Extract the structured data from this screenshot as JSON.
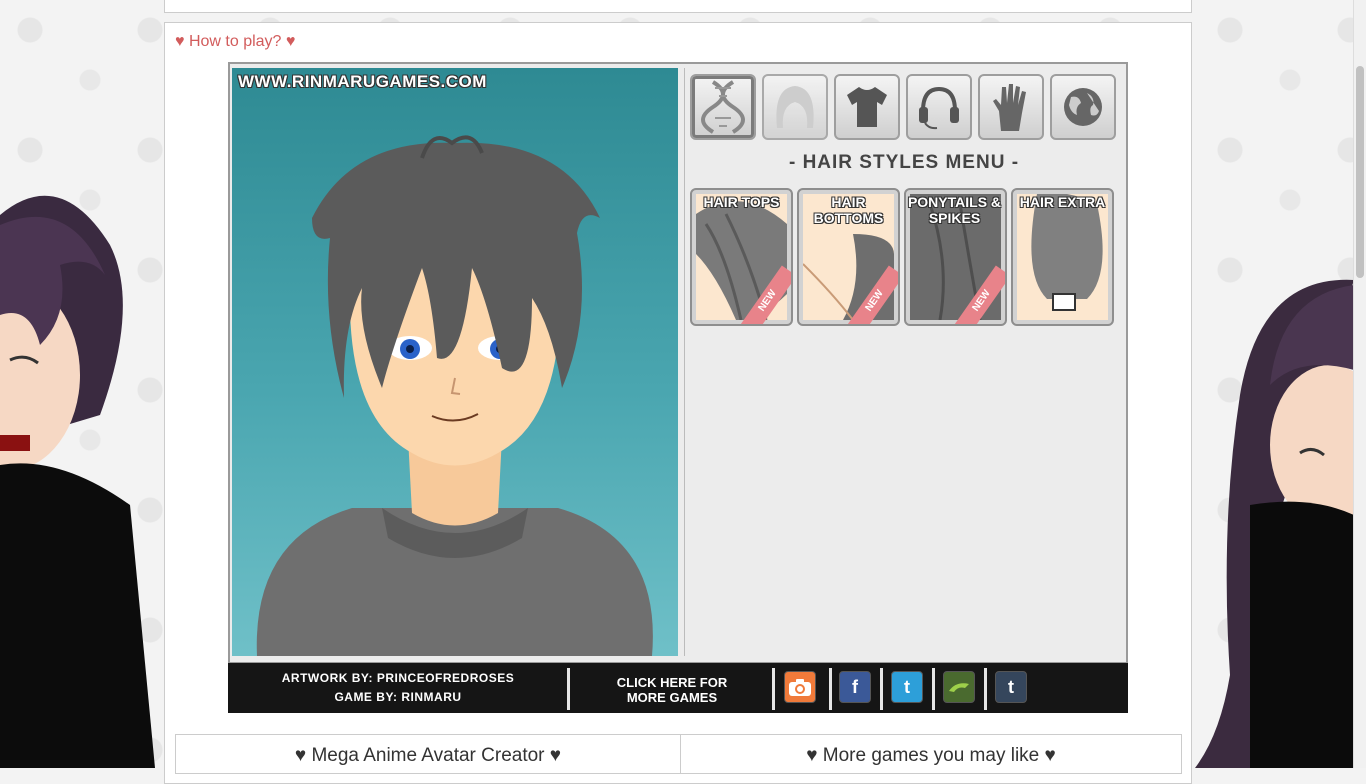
{
  "help": {
    "how_to_play": "♥ How to play? ♥"
  },
  "game": {
    "watermark": "WWW.RINMARUGAMES.COM",
    "menu_title": "- HAIR STYLES MENU -",
    "categories": [
      {
        "name": "genes",
        "icon": "dna-icon"
      },
      {
        "name": "hair",
        "icon": "hair-icon"
      },
      {
        "name": "clothes",
        "icon": "shirt-icon"
      },
      {
        "name": "accessories",
        "icon": "headphones-icon"
      },
      {
        "name": "hands",
        "icon": "hand-icon"
      },
      {
        "name": "background",
        "icon": "globe-icon"
      }
    ],
    "hair_options": [
      {
        "label": "HAIR TOPS",
        "badge": "NEW"
      },
      {
        "label": "HAIR BOTTOMS",
        "badge": "NEW"
      },
      {
        "label": "PONYTAILS & SPIKES",
        "badge": "NEW"
      },
      {
        "label": "HAIR EXTRA",
        "badge": ""
      }
    ],
    "footer": {
      "artwork": "ARTWORK BY: PRINCEOFREDROSES",
      "game_by": "GAME BY: RINMARU",
      "more_games_1": "CLICK HERE FOR",
      "more_games_2": "MORE GAMES"
    },
    "social": [
      {
        "name": "camera",
        "icon": "camera-icon",
        "color": "#f07a3a"
      },
      {
        "name": "facebook",
        "icon": "facebook-icon",
        "glyph": "f",
        "color": "#3b5998"
      },
      {
        "name": "twitter",
        "icon": "twitter-icon",
        "glyph": "t",
        "color": "#2d9fd9"
      },
      {
        "name": "deviantart",
        "icon": "deviantart-icon",
        "color": "#4a6a2f"
      },
      {
        "name": "tumblr",
        "icon": "tumblr-icon",
        "glyph": "t",
        "color": "#35465c"
      }
    ]
  },
  "bottom": {
    "left_title": "♥ Mega Anime Avatar Creator ♥",
    "right_title": "♥ More games you may like ♥"
  },
  "colors": {
    "accent": "#d25c5c",
    "stage": "#3d9aa3"
  }
}
